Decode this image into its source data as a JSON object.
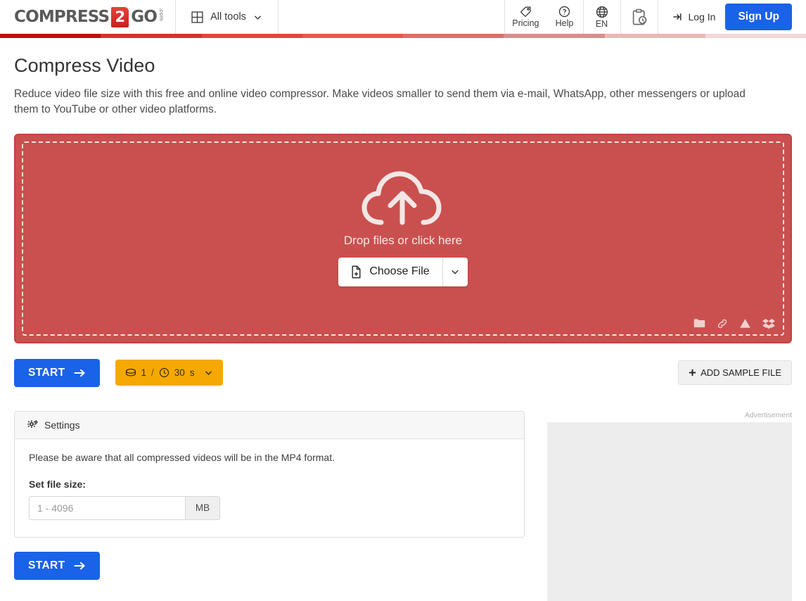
{
  "header": {
    "logo": {
      "word1": "COMPRESS",
      "badge": "2",
      "word2": "GO",
      "suffix": ".com"
    },
    "all_tools": {
      "label": "All tools",
      "icon": "grid-icon",
      "caret": "chevron-down-icon"
    },
    "pricing": {
      "label": "Pricing",
      "icon": "tag-icon"
    },
    "help": {
      "label": "Help",
      "icon": "question-circle-icon"
    },
    "language": {
      "label": "EN",
      "icon": "globe-icon"
    },
    "tasks": {
      "icon": "clipboard-clock-icon"
    },
    "login": {
      "label": "Log In",
      "icon": "sign-in-icon"
    },
    "signup": {
      "label": "Sign Up"
    }
  },
  "gradient_bar": [
    "#c00d0d",
    "#d6322c",
    "#e4453c",
    "#e8564b",
    "#dd6f68",
    "#d68f8c",
    "#e7b9b6",
    "#f4d7d5"
  ],
  "page": {
    "title": "Compress Video",
    "subtitle": "Reduce video file size with this free and online video compressor. Make videos smaller to send them via e-mail, WhatsApp, other messengers or upload them to YouTube or other video platforms."
  },
  "dropzone": {
    "icon": "cloud-upload-icon",
    "label": "Drop files or click here",
    "choose_file": {
      "label": "Choose File",
      "icon": "file-plus-icon",
      "caret": "chevron-down-icon"
    },
    "sources": [
      "folder-icon",
      "link-icon",
      "google-drive-icon",
      "dropbox-icon"
    ],
    "bg_color": "#c9504e",
    "border_color": "#c0433f"
  },
  "actions": {
    "start": {
      "label": "START",
      "icon": "arrow-right-icon",
      "color": "#1a62e8"
    },
    "quota": {
      "files_icon": "coin-icon",
      "files": "1",
      "separator": "/",
      "time_icon": "clock-icon",
      "time": "30",
      "time_unit": "s",
      "caret": "chevron-down-icon",
      "color": "#f5a800"
    },
    "add_sample": {
      "label": "ADD SAMPLE FILE",
      "icon": "plus-icon"
    }
  },
  "settings": {
    "header": {
      "label": "Settings",
      "icon": "gears-icon"
    },
    "note": "Please be aware that all compressed videos will be in the MP4 format.",
    "file_size_label": "Set file size:",
    "file_size_placeholder": "1 - 4096",
    "file_size_value": "",
    "unit": "MB"
  },
  "ad": {
    "label": "Advertisement"
  },
  "bottom_start": {
    "label": "START",
    "icon": "arrow-right-icon"
  }
}
